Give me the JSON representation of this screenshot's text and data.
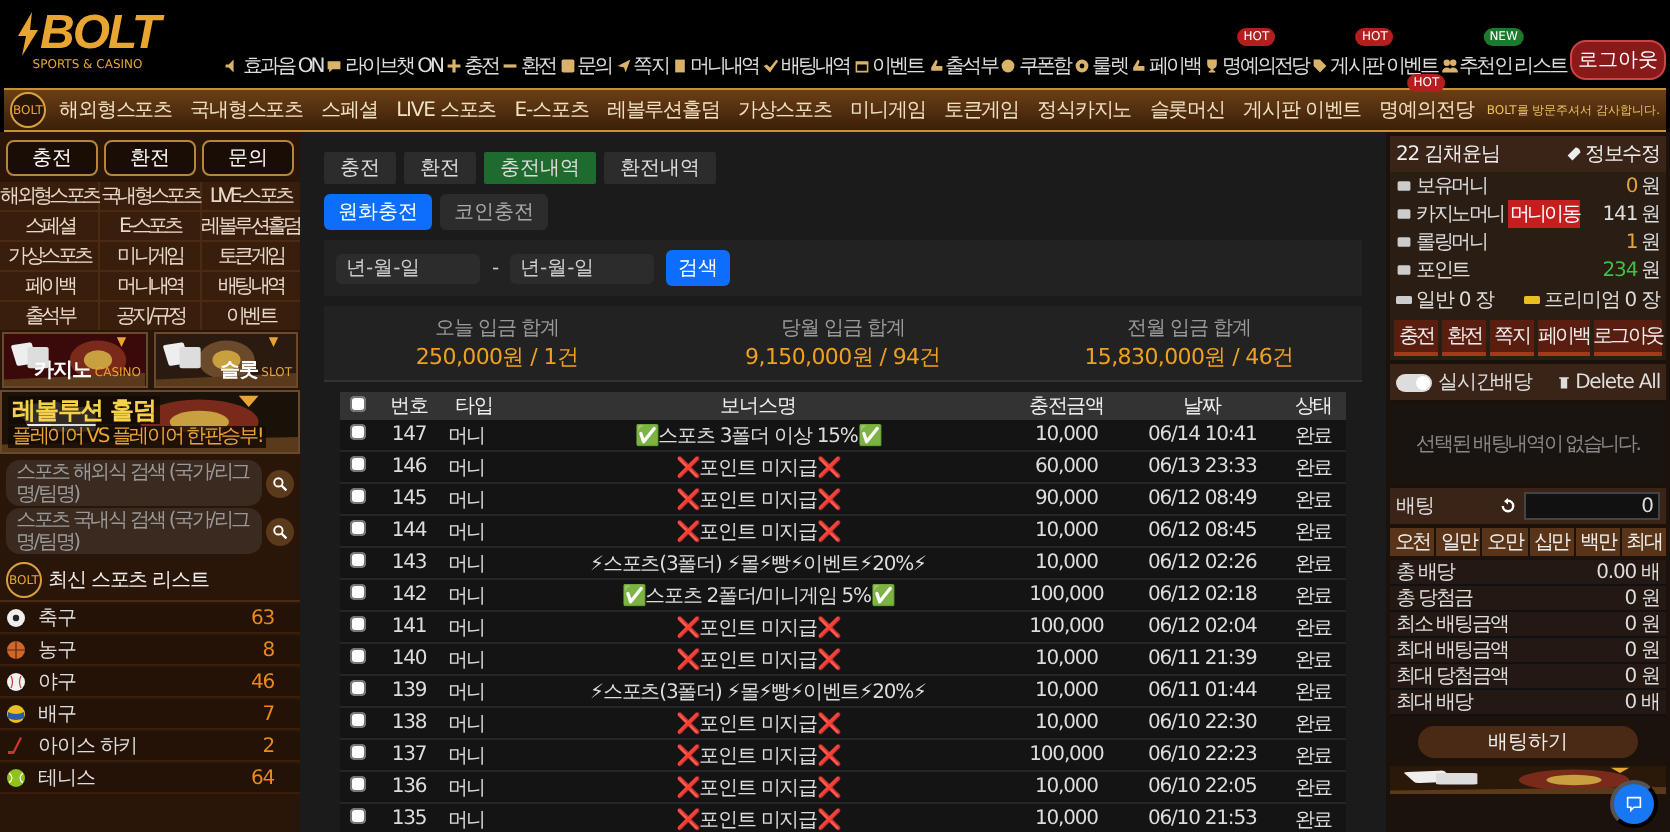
{
  "header": {
    "logo": {
      "title": "BOLT",
      "subtitle": "SPORTS & CASINO"
    },
    "menu": [
      {
        "label": "효과음 ON"
      },
      {
        "label": "라이브챗 ON"
      },
      {
        "label": "충전"
      },
      {
        "label": "환전"
      },
      {
        "label": "문의"
      },
      {
        "label": "쪽지"
      },
      {
        "label": "머니내역"
      },
      {
        "label": "배팅내역"
      },
      {
        "label": "이벤트"
      },
      {
        "label": "출석부"
      },
      {
        "label": "쿠폰함"
      },
      {
        "label": "룰렛"
      },
      {
        "label": "페이백"
      },
      {
        "label": "명예의전당",
        "badge": "HOT"
      },
      {
        "label": "게시판 이벤트",
        "badge": "HOT"
      },
      {
        "label": "추천인 리스트",
        "badge": "NEW"
      }
    ],
    "logout": "로그아웃"
  },
  "nav": {
    "side_logo": "BOLT",
    "items": [
      {
        "label": "해외형스포츠"
      },
      {
        "label": "국내형스포츠"
      },
      {
        "label": "스페셜"
      },
      {
        "label": "LIVE 스포츠"
      },
      {
        "label": "E-스포츠"
      },
      {
        "label": "레볼루션홀덤"
      },
      {
        "label": "가상스포츠"
      },
      {
        "label": "미니게임"
      },
      {
        "label": "토큰게임"
      },
      {
        "label": "정식카지노"
      },
      {
        "label": "슬롯머신"
      },
      {
        "label": "게시판 이벤트"
      },
      {
        "label": "명예의전당",
        "badge": "HOT"
      }
    ],
    "notice": "BOLT를 방문주셔서 감사합니다."
  },
  "sidebar": {
    "actions": [
      "충전",
      "환전",
      "문의"
    ],
    "menu": [
      "해외형스포츠",
      "국내형스포츠",
      "LIVE-스포츠",
      "스페셜",
      "E-스포츠",
      "레볼루션홀덤",
      "가상스포츠",
      "미니게임",
      "토큰게임",
      "페이백",
      "머니내역",
      "배팅내역",
      "출석부",
      "공지/규정",
      "이벤트"
    ],
    "banners": [
      {
        "title": "카지노",
        "subtitle": "CASINO"
      },
      {
        "title": "슬롯",
        "subtitle": "SLOT"
      }
    ],
    "holdem_banner": {
      "title": "레볼루션 홀덤",
      "subtitle": "플레이어 VS 플레이어 한판승부!"
    },
    "searches": [
      {
        "placeholder": "스포츠 해외식 검색 (국가/리그명/팀명)"
      },
      {
        "placeholder": "스포츠 국내식 검색 (국가/리그명/팀명)"
      }
    ],
    "sports_logo": "BOLT",
    "sports_title": "최신 스포츠 리스트",
    "sports": [
      {
        "name": "축구",
        "count": "63"
      },
      {
        "name": "농구",
        "count": "8"
      },
      {
        "name": "야구",
        "count": "46"
      },
      {
        "name": "배구",
        "count": "7"
      },
      {
        "name": "아이스 하키",
        "count": "2"
      },
      {
        "name": "테니스",
        "count": "64"
      }
    ]
  },
  "main": {
    "tabs": [
      {
        "label": "충전",
        "selected": false
      },
      {
        "label": "환전",
        "selected": false
      },
      {
        "label": "충전내역",
        "selected": true
      },
      {
        "label": "환전내역",
        "selected": false
      }
    ],
    "subtabs": [
      {
        "label": "원화충전",
        "selected": true
      },
      {
        "label": "코인충전",
        "selected": false
      }
    ],
    "date_from": {
      "placeholder": "년-월-일"
    },
    "date_sep": "-",
    "date_to": {
      "placeholder": "년-월-일"
    },
    "search_button": "검색",
    "summary": [
      {
        "label": "오늘 입금 합계",
        "value": "250,000원 / 1건"
      },
      {
        "label": "당월 입금 합계",
        "value": "9,150,000원 / 94건"
      },
      {
        "label": "전월 입금 합계",
        "value": "15,830,000원 / 46건"
      }
    ],
    "table": {
      "all_checked": false,
      "columns": [
        "번호",
        "타입",
        "보너스명",
        "충전금액",
        "날짜",
        "상태"
      ],
      "rows": [
        {
          "checked": false,
          "cells": [
            "147",
            "머니",
            "✅스포츠 3폴더 이상 15%✅",
            "10,000",
            "06/14 10:41",
            "완료"
          ]
        },
        {
          "checked": false,
          "cells": [
            "146",
            "머니",
            "❌포인트 미지급❌",
            "60,000",
            "06/13 23:33",
            "완료"
          ]
        },
        {
          "checked": false,
          "cells": [
            "145",
            "머니",
            "❌포인트 미지급❌",
            "90,000",
            "06/12 08:49",
            "완료"
          ]
        },
        {
          "checked": false,
          "cells": [
            "144",
            "머니",
            "❌포인트 미지급❌",
            "10,000",
            "06/12 08:45",
            "완료"
          ]
        },
        {
          "checked": false,
          "cells": [
            "143",
            "머니",
            "⚡스포츠(3폴더) ⚡몰⚡빵⚡이벤트⚡20%⚡",
            "10,000",
            "06/12 02:26",
            "완료"
          ]
        },
        {
          "checked": false,
          "cells": [
            "142",
            "머니",
            "✅스포츠 2폴더/미니게임 5%✅",
            "100,000",
            "06/12 02:18",
            "완료"
          ]
        },
        {
          "checked": false,
          "cells": [
            "141",
            "머니",
            "❌포인트 미지급❌",
            "100,000",
            "06/12 02:04",
            "완료"
          ]
        },
        {
          "checked": false,
          "cells": [
            "140",
            "머니",
            "❌포인트 미지급❌",
            "10,000",
            "06/11 21:39",
            "완료"
          ]
        },
        {
          "checked": false,
          "cells": [
            "139",
            "머니",
            "⚡스포츠(3폴더) ⚡몰⚡빵⚡이벤트⚡20%⚡",
            "10,000",
            "06/11 01:44",
            "완료"
          ]
        },
        {
          "checked": false,
          "cells": [
            "138",
            "머니",
            "❌포인트 미지급❌",
            "10,000",
            "06/10 22:30",
            "완료"
          ]
        },
        {
          "checked": false,
          "cells": [
            "137",
            "머니",
            "❌포인트 미지급❌",
            "100,000",
            "06/10 22:23",
            "완료"
          ]
        },
        {
          "checked": false,
          "cells": [
            "136",
            "머니",
            "❌포인트 미지급❌",
            "10,000",
            "06/10 22:05",
            "완료"
          ]
        },
        {
          "checked": false,
          "cells": [
            "135",
            "머니",
            "❌포인트 미지급❌",
            "10,000",
            "06/10 21:53",
            "완료"
          ]
        }
      ]
    }
  },
  "account": {
    "user": "22 김채윤님",
    "edit": "정보수정",
    "balances": [
      {
        "label": "보유머니",
        "value": "0",
        "unit": "원"
      },
      {
        "label": "카지노머니",
        "action": "머니이동",
        "value": "141",
        "unit": "원"
      },
      {
        "label": "롤링머니",
        "value": "1",
        "unit": "원"
      },
      {
        "label": "포인트",
        "value": "234",
        "unit": "원",
        "kind": "points"
      }
    ],
    "tickets": [
      {
        "label": "일반 0 장"
      },
      {
        "label": "프리미엄 0 장"
      }
    ],
    "buttons": [
      "충전",
      "환전",
      "쪽지",
      "페이백",
      "로그아웃"
    ],
    "live_odds": {
      "label": "실시간배당",
      "on": true
    },
    "delete_all": "Delete All",
    "empty": "선택된 배팅내역이 없습니다.",
    "bet": {
      "label": "배팅",
      "value": "0",
      "quick": [
        "오천",
        "일만",
        "오만",
        "십만",
        "백만",
        "최대"
      ],
      "stats": [
        {
          "label": "총 배당",
          "value": "0.00 배"
        },
        {
          "label": "총 당첨금",
          "value": "0 원"
        },
        {
          "label": "최소 배팅금액",
          "value": "0 원"
        },
        {
          "label": "최대 배팅금액",
          "value": "0 원"
        },
        {
          "label": "최대 당첨금액",
          "value": "0 원"
        },
        {
          "label": "최대 배당",
          "value": "0 배"
        }
      ],
      "submit": "배팅하기"
    }
  }
}
